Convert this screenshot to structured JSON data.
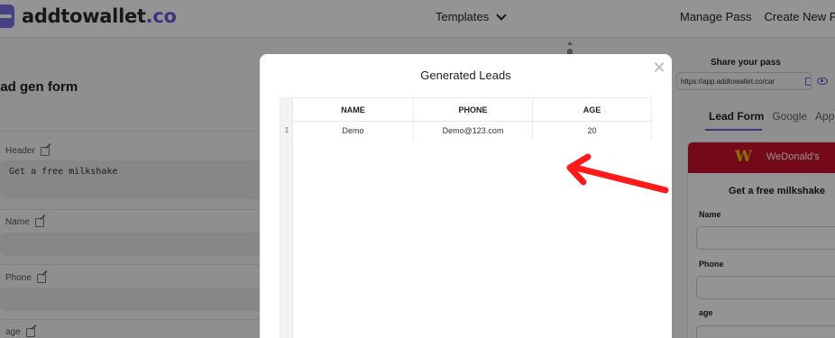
{
  "header": {
    "logo_main": "addtowallet",
    "logo_tld": ".co",
    "templates_label": "Templates",
    "manage_pass": "Manage Pass",
    "create_new_pass": "Create New Pass"
  },
  "form": {
    "title": "ead gen form",
    "fields": [
      {
        "label": "Header",
        "value": "Get a free milkshake"
      },
      {
        "label": "Name",
        "value": ""
      },
      {
        "label": "Phone",
        "value": ""
      },
      {
        "label": "age",
        "value": ""
      }
    ]
  },
  "share": {
    "title": "Share your pass",
    "url": "https://app.addtowallet.co/car"
  },
  "tabs": [
    "Lead Form",
    "Google",
    "App"
  ],
  "preview": {
    "logo_letter": "W",
    "brand": "WeDonald's",
    "title": "Get a free milkshake",
    "labels": [
      "Name",
      "Phone",
      "age"
    ]
  },
  "modal": {
    "title": "Generated Leads",
    "columns": [
      "NAME",
      "PHONE",
      "AGE"
    ],
    "rows": [
      {
        "num": "1",
        "name": "Demo",
        "phone": "Demo@123.com",
        "age": "20"
      }
    ]
  },
  "colors": {
    "accent": "#6a5ae0",
    "brand_red": "#c8102e",
    "annotation_arrow": "#ff1a1a"
  }
}
